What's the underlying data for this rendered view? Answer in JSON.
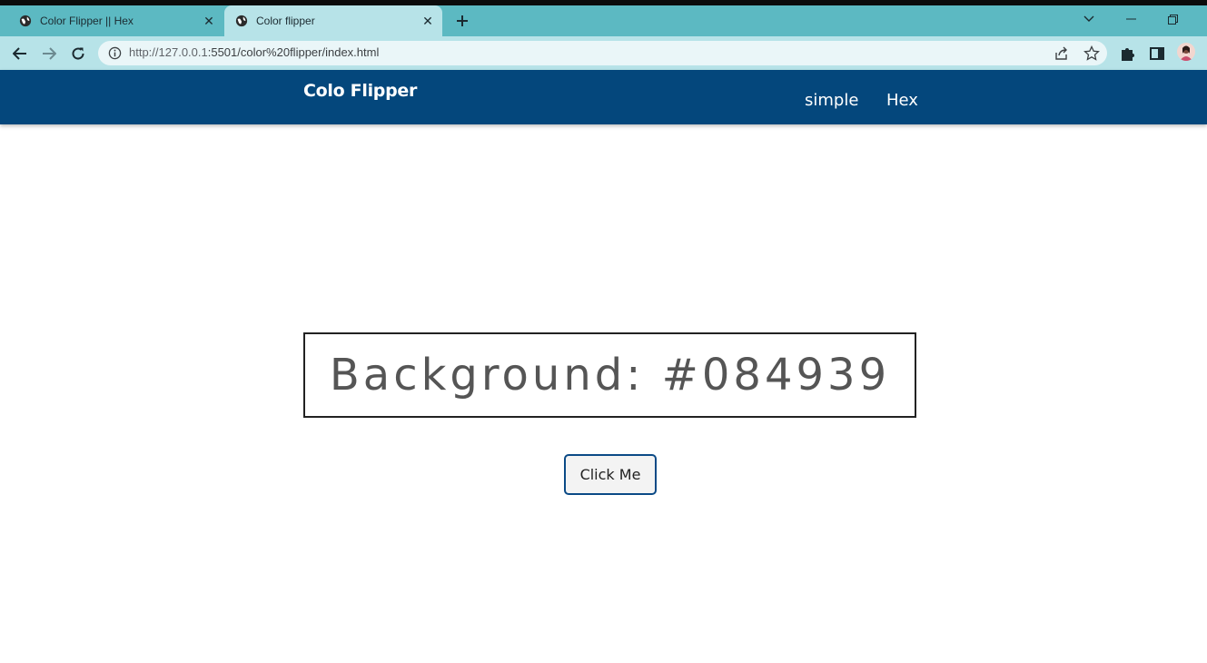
{
  "browser": {
    "tabs": [
      {
        "title": "Color Flipper || Hex",
        "icon": "globe-icon",
        "active": false
      },
      {
        "title": "Color flipper",
        "icon": "globe-icon",
        "active": true
      }
    ],
    "url": {
      "host": "http://127.0.0.1",
      "rest": ":5501/color%20flipper/index.html"
    }
  },
  "site": {
    "brand": "Colo Flipper",
    "nav": {
      "simple": "simple",
      "hex": "Hex"
    }
  },
  "main": {
    "background_text": "Background: #084939",
    "button_label": "Click Me"
  },
  "colors": {
    "tabbar": "#5cb9c2",
    "active_tab": "#b7e3e8",
    "navbar": "#04477c",
    "button_border": "#0b4a86"
  }
}
